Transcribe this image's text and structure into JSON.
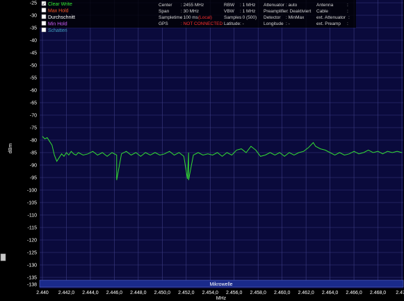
{
  "chart_data": {
    "type": "line",
    "xlabel": "MHz",
    "ylabel": "dBm",
    "xlim": [
      2.44,
      2.47
    ],
    "ylim": [
      -138,
      -25
    ],
    "x_ticks": [
      "2.440",
      "2.442,0",
      "2.444,0",
      "2.446,0",
      "2.448,0",
      "2.450,0",
      "2.452,0",
      "2.454,0",
      "2.456,0",
      "2.458,0",
      "2.460,0",
      "2.462,0",
      "2.464,0",
      "2.466,0",
      "2.468,0",
      "2.470"
    ],
    "y_ticks": [
      "-25",
      "-30",
      "-35",
      "-40",
      "-45",
      "-50",
      "-55",
      "-60",
      "-65",
      "-70",
      "-75",
      "-80",
      "-85",
      "-90",
      "-95",
      "-100",
      "-105",
      "-110",
      "-115",
      "-120",
      "-125",
      "-130",
      "-135",
      "-138"
    ],
    "band_label": "Mikrowelle",
    "series": [
      {
        "name": "Clear Write",
        "color": "#33dd33",
        "points": [
          [
            2.44,
            -78.5
          ],
          [
            2.4402,
            -79.5
          ],
          [
            2.4404,
            -79
          ],
          [
            2.4406,
            -80.5
          ],
          [
            2.4408,
            -82
          ],
          [
            2.441,
            -86
          ],
          [
            2.4412,
            -88.5
          ],
          [
            2.4414,
            -87
          ],
          [
            2.4416,
            -85.5
          ],
          [
            2.4418,
            -86.5
          ],
          [
            2.442,
            -85
          ],
          [
            2.4422,
            -86
          ],
          [
            2.4424,
            -84.5
          ],
          [
            2.4426,
            -85.5
          ],
          [
            2.4428,
            -86
          ],
          [
            2.443,
            -85
          ],
          [
            2.4434,
            -86
          ],
          [
            2.4438,
            -85.5
          ],
          [
            2.4442,
            -84.5
          ],
          [
            2.4446,
            -86
          ],
          [
            2.445,
            -85
          ],
          [
            2.4454,
            -86.5
          ],
          [
            2.4458,
            -85
          ],
          [
            2.4462,
            -86
          ],
          [
            2.4466,
            -85.5
          ],
          [
            2.447,
            -84.5
          ],
          [
            2.4474,
            -86
          ],
          [
            2.4478,
            -85
          ],
          [
            2.4482,
            -86.5
          ],
          [
            2.4486,
            -85
          ],
          [
            2.449,
            -86
          ],
          [
            2.4494,
            -85
          ],
          [
            2.4498,
            -86
          ],
          [
            2.4502,
            -85.5
          ],
          [
            2.4506,
            -84.5
          ],
          [
            2.451,
            -86
          ],
          [
            2.4514,
            -85
          ],
          [
            2.4518,
            -86.5
          ],
          [
            2.4522,
            -85
          ],
          [
            2.4526,
            -86
          ],
          [
            2.453,
            -85
          ],
          [
            2.4534,
            -86
          ],
          [
            2.4538,
            -85.5
          ],
          [
            2.4542,
            -86
          ],
          [
            2.4546,
            -85
          ],
          [
            2.455,
            -86.5
          ],
          [
            2.4554,
            -85
          ],
          [
            2.4558,
            -86
          ],
          [
            2.4562,
            -84
          ],
          [
            2.4566,
            -83.5
          ],
          [
            2.457,
            -85
          ],
          [
            2.4574,
            -82.5
          ],
          [
            2.4578,
            -84
          ],
          [
            2.4582,
            -86.5
          ],
          [
            2.4586,
            -86
          ],
          [
            2.459,
            -85
          ],
          [
            2.4594,
            -86
          ],
          [
            2.4598,
            -85
          ],
          [
            2.4602,
            -86.5
          ],
          [
            2.4606,
            -85
          ],
          [
            2.461,
            -86
          ],
          [
            2.4614,
            -85
          ],
          [
            2.4618,
            -84.5
          ],
          [
            2.4622,
            -83
          ],
          [
            2.4626,
            -81
          ],
          [
            2.4628,
            -82.5
          ],
          [
            2.4632,
            -83.5
          ],
          [
            2.4636,
            -84
          ],
          [
            2.464,
            -85
          ],
          [
            2.4644,
            -86
          ],
          [
            2.4648,
            -85
          ],
          [
            2.4652,
            -86
          ],
          [
            2.4656,
            -85.5
          ],
          [
            2.466,
            -84.5
          ],
          [
            2.4664,
            -85.5
          ],
          [
            2.4668,
            -85
          ],
          [
            2.4672,
            -84
          ],
          [
            2.4676,
            -85
          ],
          [
            2.468,
            -84.5
          ],
          [
            2.4684,
            -85.5
          ],
          [
            2.4688,
            -84.5
          ],
          [
            2.4692,
            -85
          ],
          [
            2.4696,
            -84.5
          ],
          [
            2.47,
            -85
          ]
        ]
      }
    ],
    "spikes_down": [
      {
        "x": 2.4462,
        "y": -96
      },
      {
        "x": 2.4521,
        "y": -95.5
      },
      {
        "x": 2.4522,
        "y": -96
      }
    ]
  },
  "legend": {
    "items": [
      {
        "label": "Clear Write",
        "color": "#33ee33",
        "checked": "✓"
      },
      {
        "label": "Max Hold",
        "color": "#ff5a2a",
        "checked": ""
      },
      {
        "label": "Durchschnitt",
        "color": "#ffffff",
        "checked": ""
      },
      {
        "label": "Min Hold",
        "color": "#d060ff",
        "checked": ""
      },
      {
        "label": "Schatten",
        "color": "#40a0c0",
        "checked": ""
      }
    ]
  },
  "info": {
    "center_label": "Center",
    "center_value": ": 2455 MHz",
    "span_label": "Span",
    "span_value": ": 30 MHz",
    "sampletime_label": "Sampletime",
    "sampletime_value": ": 100 ms",
    "sampletime_extra": "(Local)",
    "gps_label": "GPS",
    "gps_value": ": NOT CONNECTED",
    "rbw_label": "RBW",
    "rbw_value": ": 1 MHz",
    "vbw_label": "VBW",
    "vbw_value": ": 1 MHz",
    "samples_label": "Samples",
    "samples_value": ": 0 (500)",
    "latitude_label": "Latitude",
    "latitude_value": ": -",
    "attenuator_label": "Attenuator",
    "attenuator_value": ": auto",
    "preamp_label": "Preamplifier",
    "preamp_value": ": Deaktiviert",
    "detector_label": "Detector",
    "detector_value": ": MinMax",
    "longitude_label": "Longitude",
    "longitude_value": ": -",
    "antenna_label": "Antenna",
    "antenna_value": ":",
    "cable_label": "Cable",
    "cable_value": ":",
    "ext_att_label": "ext. Attenuator",
    "ext_att_value": ":",
    "ext_preamp_label": "ext. Preamp",
    "ext_preamp_value": ":"
  },
  "colors": {
    "plot_bg": "#0a0a3c",
    "grid": "#3c3c84",
    "trace": "#33dd33",
    "band": "#1a2a8a"
  }
}
